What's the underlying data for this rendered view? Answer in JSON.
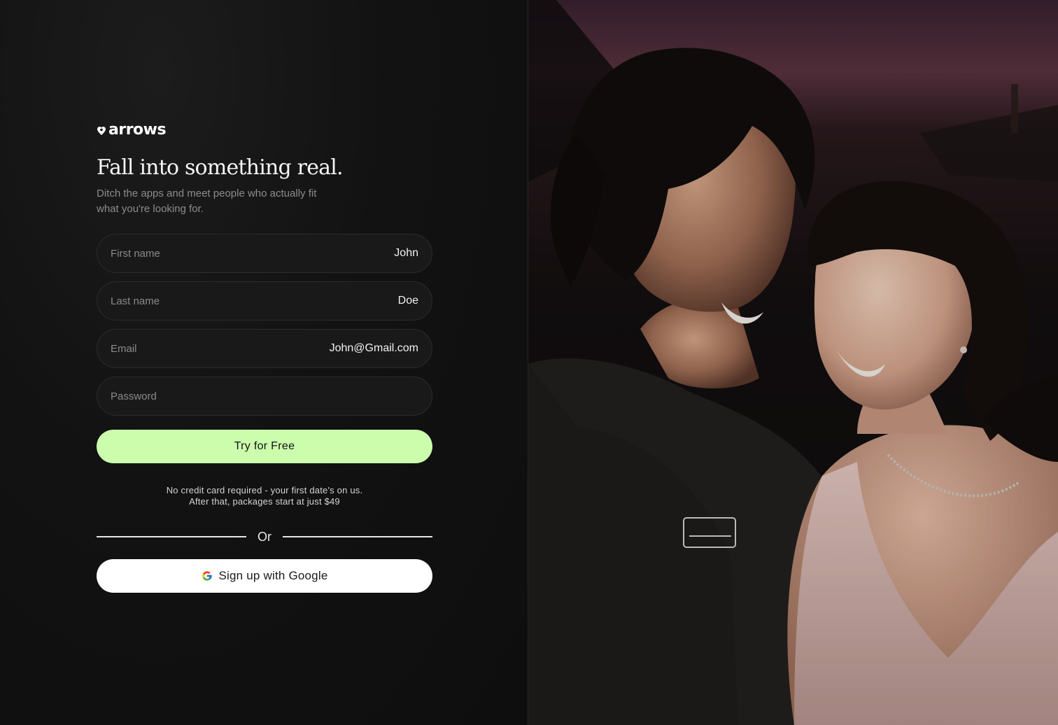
{
  "brand": {
    "name": "arrows"
  },
  "hero": {
    "headline": "Fall into something real.",
    "subheadline": "Ditch the apps and meet people who actually fit what you're looking for."
  },
  "form": {
    "first_name": {
      "label": "First name",
      "value": "John"
    },
    "last_name": {
      "label": "Last name",
      "value": "Doe"
    },
    "email": {
      "label": "Email",
      "value": "John@Gmail.com"
    },
    "password": {
      "label": "Password",
      "value": ""
    },
    "submit_label": "Try for Free",
    "note_line1": "No credit card required - your first date's on us.",
    "note_line2": "After that, packages start at just $49",
    "divider_text": "Or",
    "google_label": "Sign up with Google"
  },
  "colors": {
    "accent": "#cbfdad",
    "background": "#0f0f0f",
    "field_background": "#191919"
  },
  "image": {
    "alt": "Couple laughing together at dusk"
  }
}
